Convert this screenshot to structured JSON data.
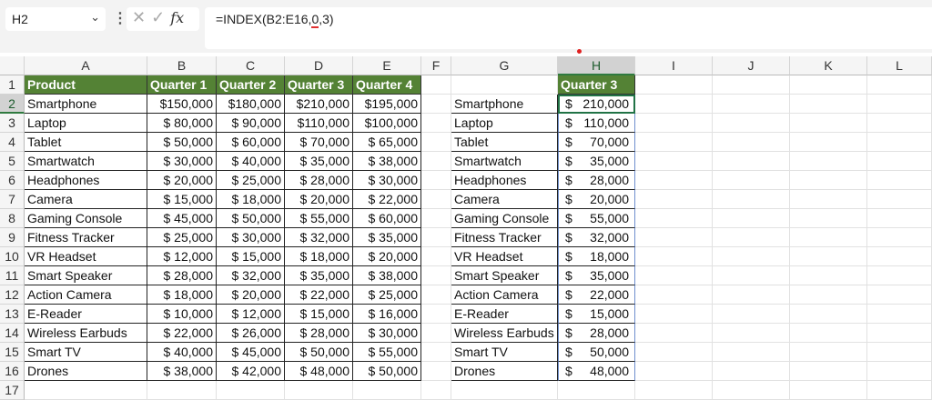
{
  "formula_bar": {
    "name_box": "H2",
    "formula_prefix": "=INDEX(B2:E16,",
    "formula_flag": "0",
    "formula_suffix": ",3)",
    "cancel_icon": "x-icon",
    "enter_icon": "check-icon",
    "fx_label": "fx"
  },
  "columns": [
    "A",
    "B",
    "C",
    "D",
    "E",
    "F",
    "G",
    "H",
    "I",
    "J",
    "K",
    "L"
  ],
  "rows": [
    "1",
    "2",
    "3",
    "4",
    "5",
    "6",
    "7",
    "8",
    "9",
    "10",
    "11",
    "12",
    "13",
    "14",
    "15",
    "16",
    "17"
  ],
  "selected_column": "H",
  "selected_row": "2",
  "selected_cell": "H2",
  "header_color": "#548235",
  "table1": {
    "headers": [
      "Product",
      "Quarter 1",
      "Quarter 2",
      "Quarter 3",
      "Quarter 4"
    ],
    "rows": [
      [
        "Smartphone",
        "$150,000",
        "$180,000",
        "$210,000",
        "$195,000"
      ],
      [
        "Laptop",
        "$ 80,000",
        "$ 90,000",
        "$110,000",
        "$100,000"
      ],
      [
        "Tablet",
        "$ 50,000",
        "$ 60,000",
        "$ 70,000",
        "$ 65,000"
      ],
      [
        "Smartwatch",
        "$ 30,000",
        "$ 40,000",
        "$ 35,000",
        "$ 38,000"
      ],
      [
        "Headphones",
        "$ 20,000",
        "$ 25,000",
        "$ 28,000",
        "$ 30,000"
      ],
      [
        "Camera",
        "$ 15,000",
        "$ 18,000",
        "$ 20,000",
        "$ 22,000"
      ],
      [
        "Gaming Console",
        "$ 45,000",
        "$ 50,000",
        "$ 55,000",
        "$ 60,000"
      ],
      [
        "Fitness Tracker",
        "$ 25,000",
        "$ 30,000",
        "$ 32,000",
        "$ 35,000"
      ],
      [
        "VR Headset",
        "$ 12,000",
        "$ 15,000",
        "$ 18,000",
        "$ 20,000"
      ],
      [
        "Smart Speaker",
        "$ 28,000",
        "$ 32,000",
        "$ 35,000",
        "$ 38,000"
      ],
      [
        "Action Camera",
        "$ 18,000",
        "$ 20,000",
        "$ 22,000",
        "$ 25,000"
      ],
      [
        "E-Reader",
        "$ 10,000",
        "$ 12,000",
        "$ 15,000",
        "$ 16,000"
      ],
      [
        "Wireless Earbuds",
        "$ 22,000",
        "$ 26,000",
        "$ 28,000",
        "$ 30,000"
      ],
      [
        "Smart TV",
        "$ 40,000",
        "$ 45,000",
        "$ 50,000",
        "$ 55,000"
      ],
      [
        "Drones",
        "$ 38,000",
        "$ 42,000",
        "$ 48,000",
        "$ 50,000"
      ]
    ]
  },
  "table2": {
    "header": "Quarter 3",
    "currency": "$",
    "products": [
      "Smartphone",
      "Laptop",
      "Tablet",
      "Smartwatch",
      "Headphones",
      "Camera",
      "Gaming Console",
      "Fitness Tracker",
      "VR Headset",
      "Smart Speaker",
      "Action Camera",
      "E-Reader",
      "Wireless Earbuds",
      "Smart TV",
      "Drones"
    ],
    "values": [
      "210,000",
      "110,000",
      "70,000",
      "35,000",
      "28,000",
      "20,000",
      "55,000",
      "32,000",
      "18,000",
      "35,000",
      "22,000",
      "15,000",
      "28,000",
      "50,000",
      "48,000"
    ]
  }
}
